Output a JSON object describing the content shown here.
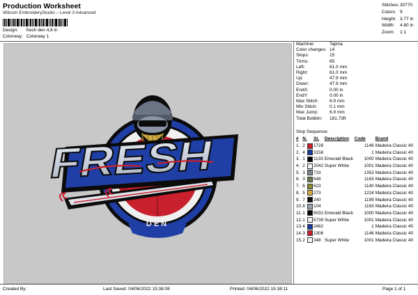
{
  "header": {
    "title": "Production Worksheet",
    "subtitle": "Wilcom EmbroideryStudio – Level 3 Advanced",
    "design_label": "Design:",
    "design_value": "fresh den 4,8 in",
    "colorway_label": "Colorway:",
    "colorway_value": "Colorway 1"
  },
  "stats": [
    {
      "k": "Stitches:",
      "v": "30770"
    },
    {
      "k": "Colors:",
      "v": "9"
    },
    {
      "k": "Height:",
      "v": "3.77 in"
    },
    {
      "k": "Width:",
      "v": "4.80 in"
    },
    {
      "k": "Zoom:",
      "v": "1:1"
    }
  ],
  "info": [
    {
      "k": "Machine:",
      "v": "Tajima"
    },
    {
      "k": "Color changes:",
      "v": "14"
    },
    {
      "k": "Stops:",
      "v": "15"
    },
    {
      "k": "Trims:",
      "v": "65"
    },
    {
      "k": "Left:",
      "v": "61.0 mm"
    },
    {
      "k": "Right:",
      "v": "61.0 mm"
    },
    {
      "k": "Up:",
      "v": "47.9 mm"
    },
    {
      "k": "Down:",
      "v": "47.9 mm"
    },
    {
      "k": "EndX:",
      "v": "0.00 in"
    },
    {
      "k": "EndY:",
      "v": "0.00 in"
    },
    {
      "k": "Max Stitch:",
      "v": "6.9 mm"
    },
    {
      "k": "Min Stitch:",
      "v": "0.1 mm"
    },
    {
      "k": "Max Jump:",
      "v": "6.9 mm"
    },
    {
      "k": "Total Bobbin:",
      "v": "181.73ft"
    }
  ],
  "sequence": {
    "label": "Stop Sequence:",
    "headers": {
      "n": "#",
      "n_extra": "N.",
      "st": "St.",
      "desc": "Description",
      "code": "Code",
      "brand": "Brand"
    },
    "rows": [
      {
        "n": "1.",
        "s": "2",
        "color": "#c8202c",
        "code": "1728",
        "desc": "",
        "st": "1146",
        "brand": "Madeira Classic 40"
      },
      {
        "n": "2.",
        "s": "4",
        "color": "#1a3aa0",
        "code": "3158",
        "desc": "",
        "st": "1",
        "brand": "Madeira Classic 40"
      },
      {
        "n": "3.",
        "s": "1",
        "color": "#050505",
        "code": "1133",
        "desc": "Emerald Black",
        "st": "1000",
        "brand": "Madeira Classic 40"
      },
      {
        "n": "4.",
        "s": "2",
        "color": "#f2f2f2",
        "code": "2042",
        "desc": "Super White",
        "st": "1001",
        "brand": "Madeira Classic 40"
      },
      {
        "n": "5.",
        "s": "3",
        "color": "#808890",
        "code": "733",
        "desc": "",
        "st": "1353",
        "brand": "Madeira Classic 40"
      },
      {
        "n": "6.",
        "s": "3",
        "color": "#6c7a50",
        "code": "648",
        "desc": "",
        "st": "1163",
        "brand": "Madeira Classic 40"
      },
      {
        "n": "7.",
        "s": "6",
        "color": "#8a8a30",
        "code": "623",
        "desc": "",
        "st": "1140",
        "brand": "Madeira Classic 40"
      },
      {
        "n": "8.",
        "s": "5",
        "color": "#d4a840",
        "code": "273",
        "desc": "",
        "st": "1224",
        "brand": "Madeira Classic 40"
      },
      {
        "n": "9.",
        "s": "7",
        "color": "#101010",
        "code": "240",
        "desc": "",
        "st": "1199",
        "brand": "Madeira Classic 40"
      },
      {
        "n": "10.",
        "s": "8",
        "color": "#9aa2aa",
        "code": "104",
        "desc": "",
        "st": "1163",
        "brand": "Madeira Classic 40"
      },
      {
        "n": "11.",
        "s": "1",
        "color": "#050505",
        "code": "9031",
        "desc": "Emerald Black",
        "st": "1000",
        "brand": "Madeira Classic 40"
      },
      {
        "n": "12.",
        "s": "1",
        "color": "#f2f2f2",
        "code": "6739",
        "desc": "Super White",
        "st": "1001",
        "brand": "Madeira Classic 40"
      },
      {
        "n": "13.",
        "s": "4",
        "color": "#1a3aa0",
        "code": "2462",
        "desc": "",
        "st": "1",
        "brand": "Madeira Classic 40"
      },
      {
        "n": "14.",
        "s": "3",
        "color": "#c8202c",
        "code": "1306",
        "desc": "",
        "st": "1146",
        "brand": "Madeira Classic 40"
      },
      {
        "n": "15.",
        "s": "2",
        "color": "#f2f2f2",
        "code": "348",
        "desc": "Super White",
        "st": "1001",
        "brand": "Madeira Classic 40"
      }
    ]
  },
  "design_art": {
    "word_main": "FRESH",
    "word_sub": "DEN"
  },
  "footer": {
    "created": "Created By:",
    "saved": "Last Saved: 04/06/2022 15:38:08",
    "printed": "Printed: 04/06/2022 15:38:11",
    "page": "Page 1 of 1"
  }
}
